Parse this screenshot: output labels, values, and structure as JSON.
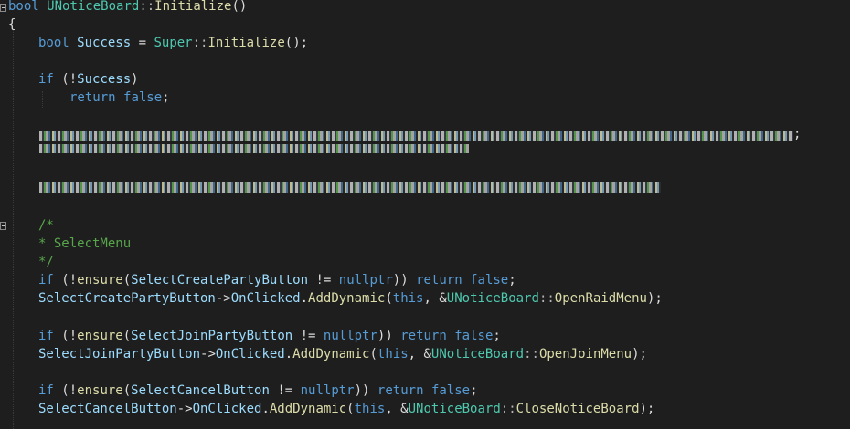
{
  "code": {
    "line1": {
      "kw": "bool",
      "cls": "UNoticeBoard",
      "sep": "::",
      "fn": "Initialize",
      "punct": "()"
    },
    "line2": {
      "punct": "{"
    },
    "line3": {
      "kw": "bool",
      "var": "Success",
      "eq": " = ",
      "super": "Super",
      "sep": "::",
      "fn": "Initialize",
      "punct": "();"
    },
    "line5": {
      "kw": "if",
      "open": " (!",
      "var": "Success",
      "close": ")"
    },
    "line6": {
      "kw": "return",
      "val": "false",
      "semi": ";"
    },
    "line8": {
      "tail": ";"
    },
    "line14": {
      "text": "/*"
    },
    "line15": {
      "text": "* SelectMenu"
    },
    "line16": {
      "text": "*/"
    },
    "line17": {
      "kw": "if",
      "open": " (!",
      "fn": "ensure",
      "paren": "(",
      "var": "SelectCreatePartyButton",
      "neq": " != ",
      "null": "nullptr",
      "close": ")) ",
      "ret": "return",
      "val": "false",
      "semi": ";"
    },
    "line18": {
      "var": "SelectCreatePartyButton",
      "arrow": "->",
      "evt": "OnClicked",
      "dot": ".",
      "fn": "AddDynamic",
      "paren": "(",
      "this": "this",
      "comma": ", &",
      "cls": "UNoticeBoard",
      "sep": "::",
      "method": "OpenRaidMenu",
      "close": ");"
    },
    "line20": {
      "kw": "if",
      "open": " (!",
      "fn": "ensure",
      "paren": "(",
      "var": "SelectJoinPartyButton",
      "neq": " != ",
      "null": "nullptr",
      "close": ")) ",
      "ret": "return",
      "val": "false",
      "semi": ";"
    },
    "line21": {
      "var": "SelectJoinPartyButton",
      "arrow": "->",
      "evt": "OnClicked",
      "dot": ".",
      "fn": "AddDynamic",
      "paren": "(",
      "this": "this",
      "comma": ", &",
      "cls": "UNoticeBoard",
      "sep": "::",
      "method": "OpenJoinMenu",
      "close": ");"
    },
    "line23": {
      "kw": "if",
      "open": " (!",
      "fn": "ensure",
      "paren": "(",
      "var": "SelectCancelButton",
      "neq": " != ",
      "null": "nullptr",
      "close": ")) ",
      "ret": "return",
      "val": "false",
      "semi": ";"
    },
    "line24": {
      "var": "SelectCancelButton",
      "arrow": "->",
      "evt": "OnClicked",
      "dot": ".",
      "fn": "AddDynamic",
      "paren": "(",
      "this": "this",
      "comma": ", &",
      "cls": "UNoticeBoard",
      "sep": "::",
      "method": "CloseNoticeBoard",
      "close": ");"
    }
  },
  "colors": {
    "background": "#1e1e1e",
    "keyword": "#569cd6",
    "type": "#4ec9b0",
    "variable": "#9cdcfe",
    "function": "#dcdcaa",
    "comment": "#57a64a",
    "text": "#dcdcdc"
  }
}
